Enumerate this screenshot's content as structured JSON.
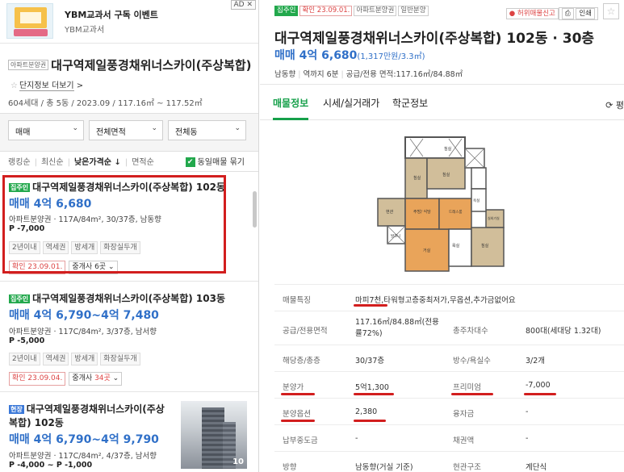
{
  "ad": {
    "thumb_text": "YBM교과서 구독 이벤트",
    "title": "YBM교과서 구독 이벤트",
    "sub": "YBM교과서",
    "badge": "AD ✕"
  },
  "complex": {
    "tag": "아파트분양권",
    "name": "대구역제일풍경채위너스카이(주상복합)",
    "link": "단지정보 더보기",
    "link_arrow": ">",
    "meta": "604세대 / 총 5동 / 2023.09 / 117.16㎡ ~ 117.52㎡"
  },
  "filters": [
    {
      "label": "매매",
      "chev": "⌄"
    },
    {
      "label": "전체면적",
      "chev": "⌄"
    },
    {
      "label": "전체동",
      "chev": "⌄"
    }
  ],
  "sort": {
    "items": [
      "랭킹순",
      "최신순",
      "낮은가격순",
      "면적순"
    ],
    "active_arrow": "↓",
    "check_label": "동일매물 묶기",
    "check_mark": "✔"
  },
  "listings": [
    {
      "badge": "집주인",
      "title": "대구역제일풍경채위너스카이(주상복합) 102동",
      "price": "매매 4억 6,680",
      "desc": "아파트분양권 · 117A/84m², 30/37층, 남동향",
      "premium": "P -7,000",
      "tags": [
        "2년이내",
        "역세권",
        "방세개",
        "화장실두개"
      ],
      "confirm": "확인 23.09.01.",
      "agent_pre": "중개사 ",
      "agent_count": "6곳",
      "agent_post": " ⌄"
    },
    {
      "badge": "집주인",
      "title": "대구역제일풍경채위너스카이(주상복합) 103동",
      "price": "매매 4억 6,790~4억 7,480",
      "desc": "아파트분양권 · 117C/84m², 3/37층, 남서향",
      "premium": "P -5,000",
      "tags": [
        "2년이내",
        "역세권",
        "방세개",
        "화장실두개"
      ],
      "confirm": "확인 23.09.04.",
      "agent_pre": "중개사 ",
      "agent_count": "34곳",
      "agent_post": " ⌄"
    },
    {
      "badge": "현장",
      "title_line1": "대구역제일풍경채위너스카이(주상",
      "title_line2": "복합) 102동",
      "price": "매매 4억 6,790~4억 9,790",
      "desc": "아파트분양권 · 117C/84m², 4/37층, 남서향",
      "premium": "P -4,000 ~ P -1,000",
      "photo_count": "10"
    }
  ],
  "detail": {
    "tags": [
      "집주인",
      "확인 23.09.01.",
      "아파트분양권",
      "일반분양"
    ],
    "report": "● 허위매물신고",
    "print": "인쇄",
    "fav": "☆",
    "title": "대구역제일풍경채위너스카이(주상복합) 102동 · 30층",
    "price": "매매 4억 6,680",
    "price_unit": "(1,317만원/3.3㎡)",
    "meta": [
      "남동향",
      "역까지 6분",
      "공급/전용 면적:117.16㎡/84.88㎡"
    ],
    "tabs": [
      "매물정보",
      "시세/실거래가",
      "학군정보"
    ],
    "refresh": "⟳ 평"
  },
  "floorplan_labels": [
    "침실",
    "침실",
    "침실",
    "현관",
    "발코니",
    "주방/ 식당",
    "거실",
    "드레스룸",
    "욕실",
    "욕실",
    "침실",
    "실외기실"
  ],
  "info_rows": [
    {
      "label": "매물특징",
      "value": "마피7천,타워형고층중최저가,무옵션,추가금없어요"
    },
    {
      "label": "공급/전용면적",
      "value": "117.16㎡/84.88㎡(전용률72%)",
      "label2": "총주차대수",
      "value2": "800대(세대당 1.32대)"
    },
    {
      "label": "해당층/총층",
      "value": "30/37층",
      "label2": "방수/욕실수",
      "value2": "3/2개"
    },
    {
      "label": "분양가",
      "value": "5억1,300",
      "label2": "프리미엄",
      "value2": "-7,000"
    },
    {
      "label": "분양옵션",
      "value": "2,380",
      "label2": "융자금",
      "value2": "-"
    },
    {
      "label": "납부중도금",
      "value": "-",
      "label2": "채권액",
      "value2": "-"
    },
    {
      "label": "방향",
      "value": "남동향(거실 기준)",
      "label2": "현관구조",
      "value2": "계단식"
    }
  ]
}
